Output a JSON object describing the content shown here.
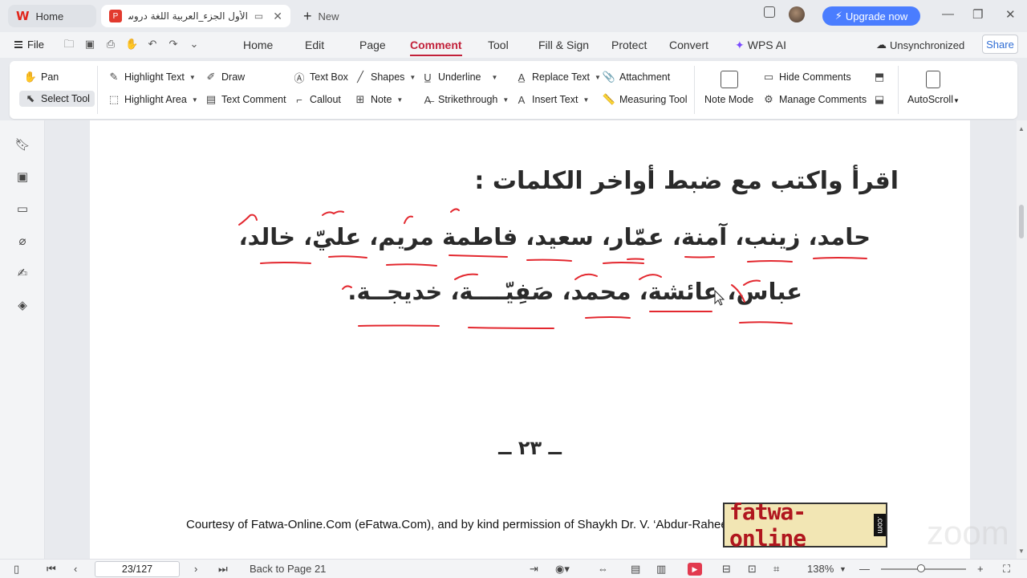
{
  "tabs": {
    "home_label": "Home",
    "doc_title": "الأول الجزء_العربية اللغة دروس",
    "new_label": "New"
  },
  "header": {
    "upgrade_label": "Upgrade now"
  },
  "menu": {
    "file": "File",
    "items": [
      "Home",
      "Edit",
      "Page",
      "Comment",
      "Tool",
      "Fill & Sign",
      "Protect",
      "Convert",
      "WPS AI"
    ],
    "active": "Comment",
    "unsync": "Unsynchronized",
    "share": "Share"
  },
  "ribbon": {
    "pan": "Pan",
    "select_tool": "Select Tool",
    "highlight_text": "Highlight Text",
    "highlight_area": "Highlight Area",
    "draw": "Draw",
    "text_comment": "Text Comment",
    "text_box": "Text Box",
    "callout": "Callout",
    "shapes": "Shapes",
    "note": "Note",
    "underline": "Underline",
    "strikethrough": "Strikethrough",
    "replace_text": "Replace Text",
    "insert_text": "Insert Text",
    "attachment": "Attachment",
    "measuring_tool": "Measuring Tool",
    "note_mode": "Note Mode",
    "hide_comments": "Hide Comments",
    "manage_comments": "Manage Comments",
    "autoscroll": "AutoScroll"
  },
  "document": {
    "heading": "اقرأ واكتب مع ضبط أواخر الكلمات :",
    "line1": "حامد، زينب، آمنة، عمّار، سعيد، فاطمة مريم، عليّ، خالد،",
    "line2": "عباس، عائشة، محمد، صَفِيّــــة، خديجــة.",
    "page_number": "ــ ٢٣ ــ",
    "courtesy": "Courtesy of Fatwa-Online.Com (eFatwa.Com), and by kind permission of Shaykh Dr. V. ‘Abdur-Raheem",
    "logo_text": "fatwa-online",
    "logo_com": ".com",
    "watermark": "zoom"
  },
  "statusbar": {
    "page_value": "23/127",
    "back_to_page": "Back to Page 21",
    "zoom": "138%",
    "zoom_level": 0.47
  },
  "colors": {
    "accent": "#c2213a",
    "upgrade": "#4a7dff",
    "annotation": "#e3282f"
  }
}
